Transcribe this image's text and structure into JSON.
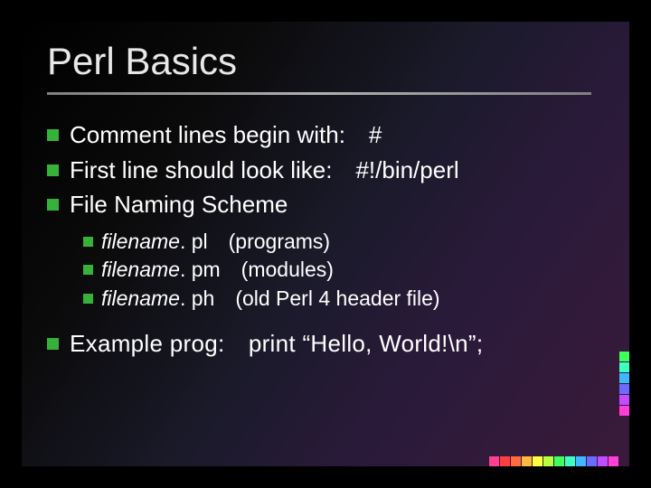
{
  "title": "Perl Basics",
  "bullets": {
    "b0": "Comment lines begin with: #",
    "b1": "First line should look like: #!/bin/perl",
    "b2": "File Naming Scheme",
    "b3": "Example prog: print “Hello, World!\\n”;"
  },
  "sub": {
    "s0_fn": "filename",
    "s0_ext": ". pl",
    "s0_desc": "(programs)",
    "s1_fn": "filename",
    "s1_ext": ". pm",
    "s1_desc": "(modules)",
    "s2_fn": "filename",
    "s2_ext": ". ph",
    "s2_desc": "(old Perl 4 header file)"
  },
  "deco_colors": {
    "c0": "#ff3fd8",
    "c1": "#c44bff",
    "c2": "#6b6bff",
    "c3": "#3fb8ff",
    "c4": "#3fffc0",
    "c5": "#3fff5a",
    "c6": "#b8ff3f",
    "c7": "#ffff3f",
    "c8": "#ffb83f",
    "c9": "#ff6b3f",
    "c10": "#ff3f3f",
    "c11": "#ff3f8f"
  }
}
